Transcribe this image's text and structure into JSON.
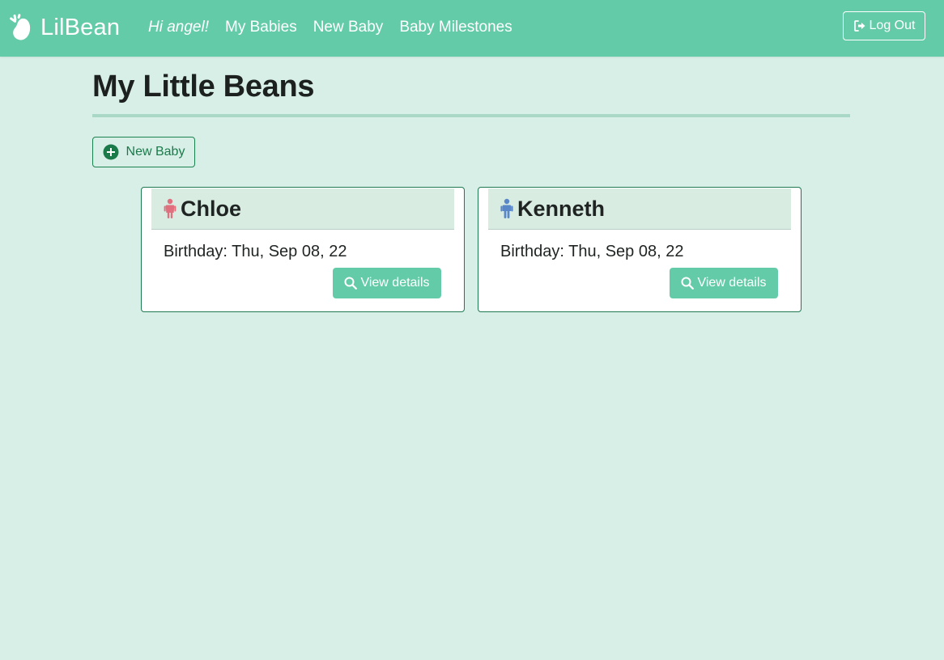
{
  "navbar": {
    "brand": "LilBean",
    "brand_icon": "bean-logo-icon",
    "greeting": "Hi angel!",
    "links": [
      "My Babies",
      "New Baby",
      "Baby Milestones"
    ],
    "logout_label": "Log Out",
    "logout_icon": "sign-out-icon",
    "background_color": "#64cba8"
  },
  "page": {
    "title": "My Little Beans",
    "new_baby_label": "New Baby",
    "new_baby_icon": "plus-circle-icon",
    "background_color": "#d8efe8"
  },
  "babies": [
    {
      "name": "Chloe",
      "gender_icon": "girl-icon",
      "icon_color": "#e0707e",
      "birthday_text": "Birthday: Thu, Sep 08, 22",
      "view_label": "View details"
    },
    {
      "name": "Kenneth",
      "gender_icon": "boy-icon",
      "icon_color": "#5a87c8",
      "birthday_text": "Birthday: Thu, Sep 08, 22",
      "view_label": "View details"
    }
  ]
}
